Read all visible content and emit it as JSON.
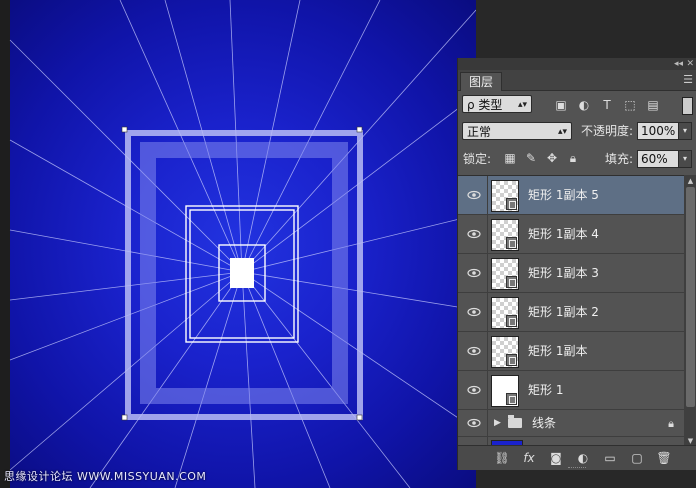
{
  "panel": {
    "tab_label": "图层",
    "filter": {
      "label": "ρ 类型"
    },
    "blend_mode": "正常",
    "opacity_label": "不透明度:",
    "opacity_value": "100%",
    "lock_label": "锁定:",
    "fill_label": "填充:",
    "fill_value": "60%",
    "layers": [
      {
        "name": "矩形 1副本 5",
        "selected": true,
        "type": "shape-transparent"
      },
      {
        "name": "矩形 1副本 4",
        "selected": false,
        "type": "shape-transparent"
      },
      {
        "name": "矩形 1副本 3",
        "selected": false,
        "type": "shape-transparent"
      },
      {
        "name": "矩形 1副本 2",
        "selected": false,
        "type": "shape-transparent"
      },
      {
        "name": "矩形 1副本",
        "selected": false,
        "type": "shape-transparent"
      },
      {
        "name": "矩形 1",
        "selected": false,
        "type": "shape-solid"
      },
      {
        "name": "线条",
        "selected": false,
        "type": "group"
      }
    ]
  },
  "watermark": "思缘设计论坛 WWW.MISSYUAN.COM",
  "colors": {
    "canvas_blue": "#1a22cc",
    "panel_bg": "#535353",
    "selected_row": "#5e6f85"
  },
  "icons": [
    "eye-icon",
    "lock-icon",
    "folder-icon",
    "link-icon",
    "fx-icon",
    "mask-icon",
    "adjustment-icon",
    "new-group-icon",
    "new-layer-icon",
    "trash-icon"
  ]
}
